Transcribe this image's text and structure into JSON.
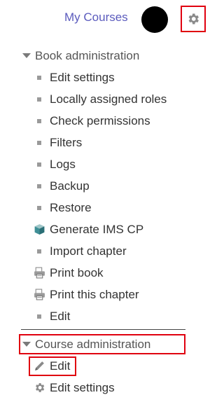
{
  "header": {
    "my_courses_label": "My Courses",
    "settings_icon": "gear-icon"
  },
  "book_admin": {
    "title": "Book administration",
    "items": [
      {
        "label": "Edit settings",
        "icon": "bullet"
      },
      {
        "label": "Locally assigned roles",
        "icon": "bullet"
      },
      {
        "label": "Check permissions",
        "icon": "bullet"
      },
      {
        "label": "Filters",
        "icon": "bullet"
      },
      {
        "label": "Logs",
        "icon": "bullet"
      },
      {
        "label": "Backup",
        "icon": "bullet"
      },
      {
        "label": "Restore",
        "icon": "bullet"
      },
      {
        "label": "Generate IMS CP",
        "icon": "package-icon"
      },
      {
        "label": "Import chapter",
        "icon": "bullet"
      },
      {
        "label": "Print book",
        "icon": "printer-icon"
      },
      {
        "label": "Print this chapter",
        "icon": "printer-icon"
      },
      {
        "label": "Edit",
        "icon": "bullet"
      }
    ]
  },
  "course_admin": {
    "title": "Course administration",
    "items": [
      {
        "label": "Edit",
        "icon": "pencil-icon"
      },
      {
        "label": "Edit settings",
        "icon": "gear-icon"
      }
    ]
  },
  "colors": {
    "highlight": "#e0000f",
    "link": "#5b5bbd"
  }
}
